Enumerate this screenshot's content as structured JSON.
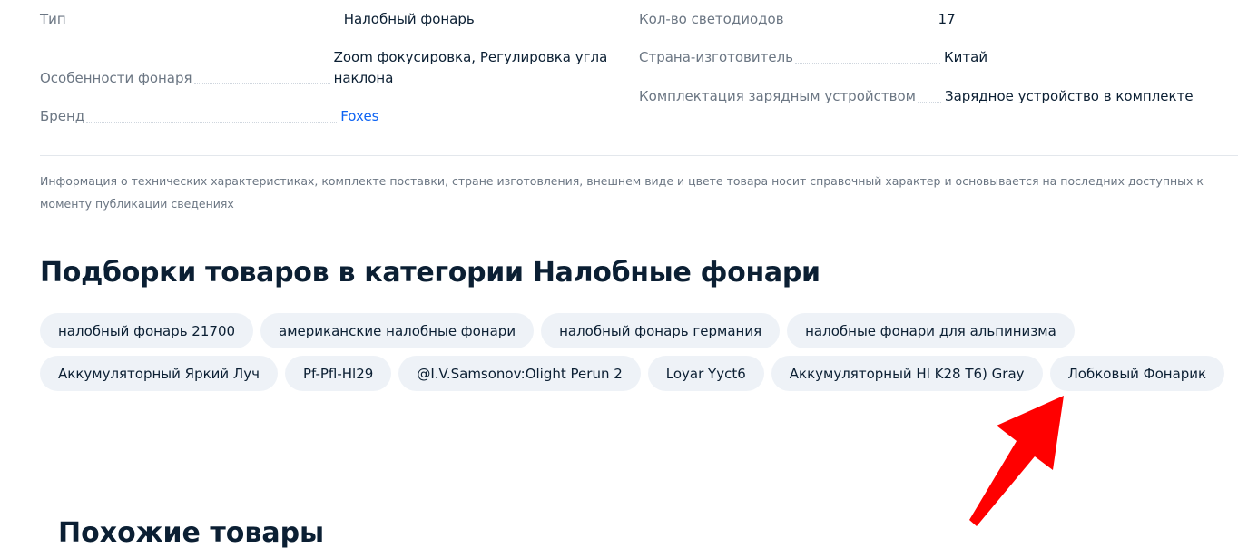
{
  "specs_left": [
    {
      "label": "Тип",
      "value": "Налобный фонарь"
    },
    {
      "label": "Особенности фонаря",
      "value_line1": "Zoom фокусировка, Регулировка угла",
      "value_line2": "наклона"
    },
    {
      "label": "Бренд",
      "value": "Foxes"
    }
  ],
  "specs_right": [
    {
      "label": "Кол-во светодиодов",
      "value": "17"
    },
    {
      "label": "Страна-изготовитель",
      "value": "Китай"
    },
    {
      "label": "Комплектация зарядным устройством",
      "value": "Зарядное устройство в комплекте"
    }
  ],
  "disclaimer": "Информация о технических характеристиках, комплекте поставки, стране изготовления, внешнем виде и цвете товара носит справочный характер и основывается на последних доступных к моменту публикации сведениях",
  "collections": {
    "title": "Подборки товаров в категории Налобные фонари",
    "row1": [
      "налобный фонарь 21700",
      "американские налобные фонари",
      "налобный фонарь германия",
      "налобные фонари для альпинизма"
    ],
    "row2": [
      "Аккумуляторный Яркий Луч",
      "Pf-Pfl-Hl29",
      "@I.V.Samsonov:Olight Perun 2",
      "Loyar Yyct6",
      "Аккумуляторный Hl K28 T6) Gray",
      "Лобковый Фонарик"
    ]
  },
  "similar_title": "Похожие товары",
  "colors": {
    "link": "#0d63f3",
    "chip_bg": "#eef2f7",
    "arrow": "#ff0000"
  }
}
